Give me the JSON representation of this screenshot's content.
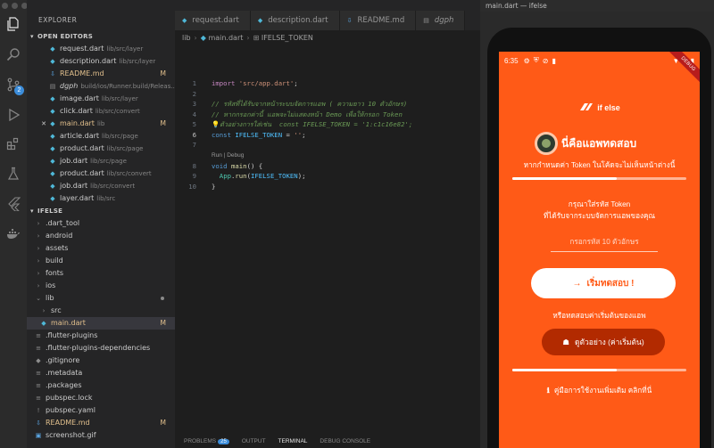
{
  "sidebar": {
    "title": "EXPLORER",
    "open_editors_label": "OPEN EDITORS",
    "open_editors": [
      {
        "icon": "dart-file-icon",
        "name": "request.dart",
        "path": "lib/src/layer",
        "status": "",
        "close": false,
        "kind": "dart"
      },
      {
        "icon": "dart-file-icon",
        "name": "description.dart",
        "path": "lib/src/layer",
        "status": "",
        "close": false,
        "kind": "dart"
      },
      {
        "icon": "markdown-file-icon",
        "name": "README.md",
        "path": "",
        "status": "M",
        "close": false,
        "kind": "md"
      },
      {
        "icon": "file-icon",
        "name": "dgph",
        "path": "build/ios/Runner.build/Releas...",
        "status": "",
        "close": false,
        "kind": "other"
      },
      {
        "icon": "dart-file-icon",
        "name": "image.dart",
        "path": "lib/src/layer",
        "status": "",
        "close": false,
        "kind": "dart"
      },
      {
        "icon": "dart-file-icon",
        "name": "click.dart",
        "path": "lib/src/convert",
        "status": "",
        "close": false,
        "kind": "dart"
      },
      {
        "icon": "dart-file-icon",
        "name": "main.dart",
        "path": "lib",
        "status": "M",
        "close": true,
        "kind": "dart"
      },
      {
        "icon": "dart-file-icon",
        "name": "article.dart",
        "path": "lib/src/page",
        "status": "",
        "close": false,
        "kind": "dart"
      },
      {
        "icon": "dart-file-icon",
        "name": "product.dart",
        "path": "lib/src/page",
        "status": "",
        "close": false,
        "kind": "dart"
      },
      {
        "icon": "dart-file-icon",
        "name": "job.dart",
        "path": "lib/src/page",
        "status": "",
        "close": false,
        "kind": "dart"
      },
      {
        "icon": "dart-file-icon",
        "name": "product.dart",
        "path": "lib/src/convert",
        "status": "",
        "close": false,
        "kind": "dart"
      },
      {
        "icon": "dart-file-icon",
        "name": "job.dart",
        "path": "lib/src/convert",
        "status": "",
        "close": false,
        "kind": "dart"
      },
      {
        "icon": "dart-file-icon",
        "name": "layer.dart",
        "path": "lib/src",
        "status": "",
        "close": false,
        "kind": "dart"
      }
    ],
    "project_label": "IFELSE",
    "tree": [
      {
        "name": ".dart_tool",
        "kind": "folder",
        "indent": 1,
        "status": ""
      },
      {
        "name": "android",
        "kind": "folder",
        "indent": 1,
        "status": ""
      },
      {
        "name": "assets",
        "kind": "folder",
        "indent": 1,
        "status": ""
      },
      {
        "name": "build",
        "kind": "folder",
        "indent": 1,
        "status": ""
      },
      {
        "name": "fonts",
        "kind": "folder",
        "indent": 1,
        "status": ""
      },
      {
        "name": "ios",
        "kind": "folder",
        "indent": 1,
        "status": ""
      },
      {
        "name": "lib",
        "kind": "folder-open",
        "indent": 1,
        "status": "dot"
      },
      {
        "name": "src",
        "kind": "folder",
        "indent": 2,
        "status": ""
      },
      {
        "name": "main.dart",
        "kind": "dart",
        "indent": 2,
        "status": "M",
        "selected": true
      },
      {
        "name": ".flutter-plugins",
        "kind": "list",
        "indent": 1,
        "status": ""
      },
      {
        "name": ".flutter-plugins-dependencies",
        "kind": "list",
        "indent": 1,
        "status": ""
      },
      {
        "name": ".gitignore",
        "kind": "git",
        "indent": 1,
        "status": ""
      },
      {
        "name": ".metadata",
        "kind": "list",
        "indent": 1,
        "status": ""
      },
      {
        "name": ".packages",
        "kind": "list",
        "indent": 1,
        "status": ""
      },
      {
        "name": "pubspec.lock",
        "kind": "list",
        "indent": 1,
        "status": ""
      },
      {
        "name": "pubspec.yaml",
        "kind": "yaml",
        "indent": 1,
        "status": ""
      },
      {
        "name": "README.md",
        "kind": "md",
        "indent": 1,
        "status": "M"
      },
      {
        "name": "screenshot.gif",
        "kind": "image",
        "indent": 1,
        "status": ""
      }
    ]
  },
  "editor": {
    "tabs": [
      {
        "label": "request.dart",
        "italic": false
      },
      {
        "label": "description.dart",
        "italic": false
      },
      {
        "label": "README.md",
        "italic": false
      },
      {
        "label": "dgph",
        "italic": true
      }
    ],
    "breadcrumb": {
      "folder": "lib",
      "file": "main.dart",
      "symbol": "IFELSE_TOKEN"
    },
    "codelens": "Run | Debug",
    "panel_tabs": [
      {
        "label": "PROBLEMS",
        "badge": "25"
      },
      {
        "label": "OUTPUT",
        "badge": ""
      },
      {
        "label": "TERMINAL",
        "badge": ""
      },
      {
        "label": "DEBUG CONSOLE",
        "badge": ""
      }
    ]
  },
  "window_title": "main.dart — ifelse",
  "phone": {
    "time": "6:35",
    "debug_ribbon": "DEBUG",
    "logo_text": "if else",
    "hero_title": "นี่คือแอพทดสอบ",
    "hint": "หากกำหนดค่า Token ในโค้ดจะไม่เห็นหน้าต่างนี้",
    "prompt_line1": "กรุณาใส่รหัส Token",
    "prompt_line2": "ที่ได้รับจากระบบจัดการแอพของคุณ",
    "token_placeholder": "กรอกรหัส 10 ตัวอักษร",
    "test_button": "เริ่มทดสอบ !",
    "or_text": "หรือทดสอบค่าเริ่มต้นของแอพ",
    "example_button": "ดูตัวอย่าง (ค่าเริ่มต้น)",
    "manual_link": "คู่มือการใช้งานเพิ่มเติม คลิกที่นี่"
  },
  "colors": {
    "accent_orange": "#ff5a17",
    "example_button": "#b22a00",
    "editor_bg": "#1e1e1e"
  }
}
